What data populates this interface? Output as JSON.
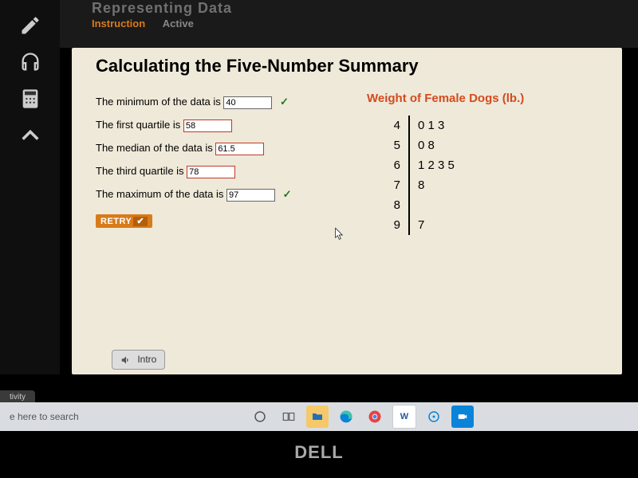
{
  "header": {
    "unit": "Representing Data",
    "tabs": [
      "Instruction",
      "Active"
    ],
    "active_tab_index": 0
  },
  "page": {
    "title": "Calculating the Five-Number Summary"
  },
  "answers": {
    "min_label": "The minimum of the data is ",
    "min_value": "40",
    "min_correct": true,
    "q1_label": "The first quartile is ",
    "q1_value": "58",
    "q1_correct": false,
    "median_label": "The median of the data is ",
    "median_value": "61.5",
    "median_correct": false,
    "q3_label": "The third quartile is ",
    "q3_value": "78",
    "q3_correct": false,
    "max_label": "The maximum of the data is ",
    "max_value": "97",
    "max_correct": true,
    "retry": "RETRY"
  },
  "stem_leaf": {
    "title": "Weight of Female Dogs (lb.)",
    "rows": [
      {
        "stem": "4",
        "leaves": "0   1   3"
      },
      {
        "stem": "5",
        "leaves": "0   8"
      },
      {
        "stem": "6",
        "leaves": "1   2   3   5"
      },
      {
        "stem": "7",
        "leaves": "8"
      },
      {
        "stem": "8",
        "leaves": ""
      },
      {
        "stem": "9",
        "leaves": "7"
      }
    ]
  },
  "intro_button": "Intro",
  "taskbar": {
    "activity": "tivity",
    "search_placeholder": "e here to search"
  },
  "laptop_logo": "DELL"
}
